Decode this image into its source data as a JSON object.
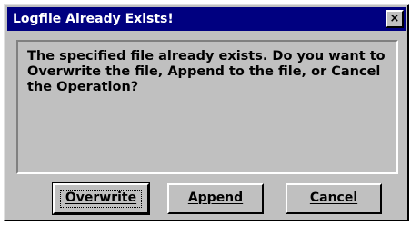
{
  "window": {
    "title": "Logfile Already Exists!",
    "close_glyph": "×"
  },
  "message": {
    "text": "The specified file already exists. Do you want to Overwrite the file, Append to the file, or Cancel the Operation?"
  },
  "buttons": {
    "overwrite_label": "Overwrite",
    "append_label": "Append",
    "cancel_label": "Cancel"
  },
  "colors": {
    "title_bar": "#000080",
    "face": "#c0c0c0"
  }
}
